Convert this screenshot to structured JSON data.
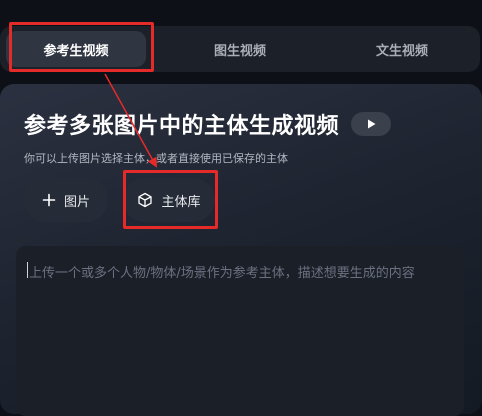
{
  "tabs": [
    {
      "label": "参考生视频",
      "active": true
    },
    {
      "label": "图生视频",
      "active": false
    },
    {
      "label": "文生视频",
      "active": false
    }
  ],
  "panel": {
    "title": "参考多张图片中的主体生成视频",
    "subtitle": "你可以上传图片选择主体，或者直接使用已保存的主体",
    "play_icon": "play-icon"
  },
  "buttons": {
    "add_image_label": "图片",
    "add_image_icon": "plus-icon",
    "subject_library_label": "主体库",
    "subject_library_icon": "cube-icon"
  },
  "prompt": {
    "placeholder": "上传一个或多个人物/物体/场景作为参考主体，描述想要生成的内容"
  },
  "annotation": {
    "highlight_color": "#e52a2a"
  }
}
